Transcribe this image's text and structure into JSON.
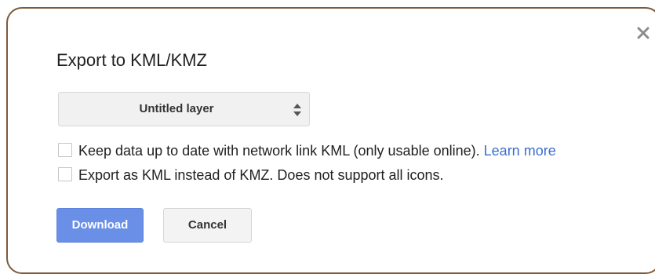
{
  "dialog": {
    "title": "Export to KML/KMZ",
    "close_icon": "close-icon"
  },
  "layer_select": {
    "selected": "Untitled layer",
    "arrow_icon": "updown-arrows-icon"
  },
  "options": [
    {
      "label": "Keep data up to date with network link KML (only usable online).",
      "link": "Learn more",
      "checked": false
    },
    {
      "label": "Export as KML instead of KMZ. Does not support all icons.",
      "checked": false
    }
  ],
  "buttons": {
    "download_label": "Download",
    "cancel_label": "Cancel"
  },
  "colors": {
    "accent": "#6a8fe6",
    "link": "#3b6fcf",
    "frame_border": "#7d5a3c"
  }
}
